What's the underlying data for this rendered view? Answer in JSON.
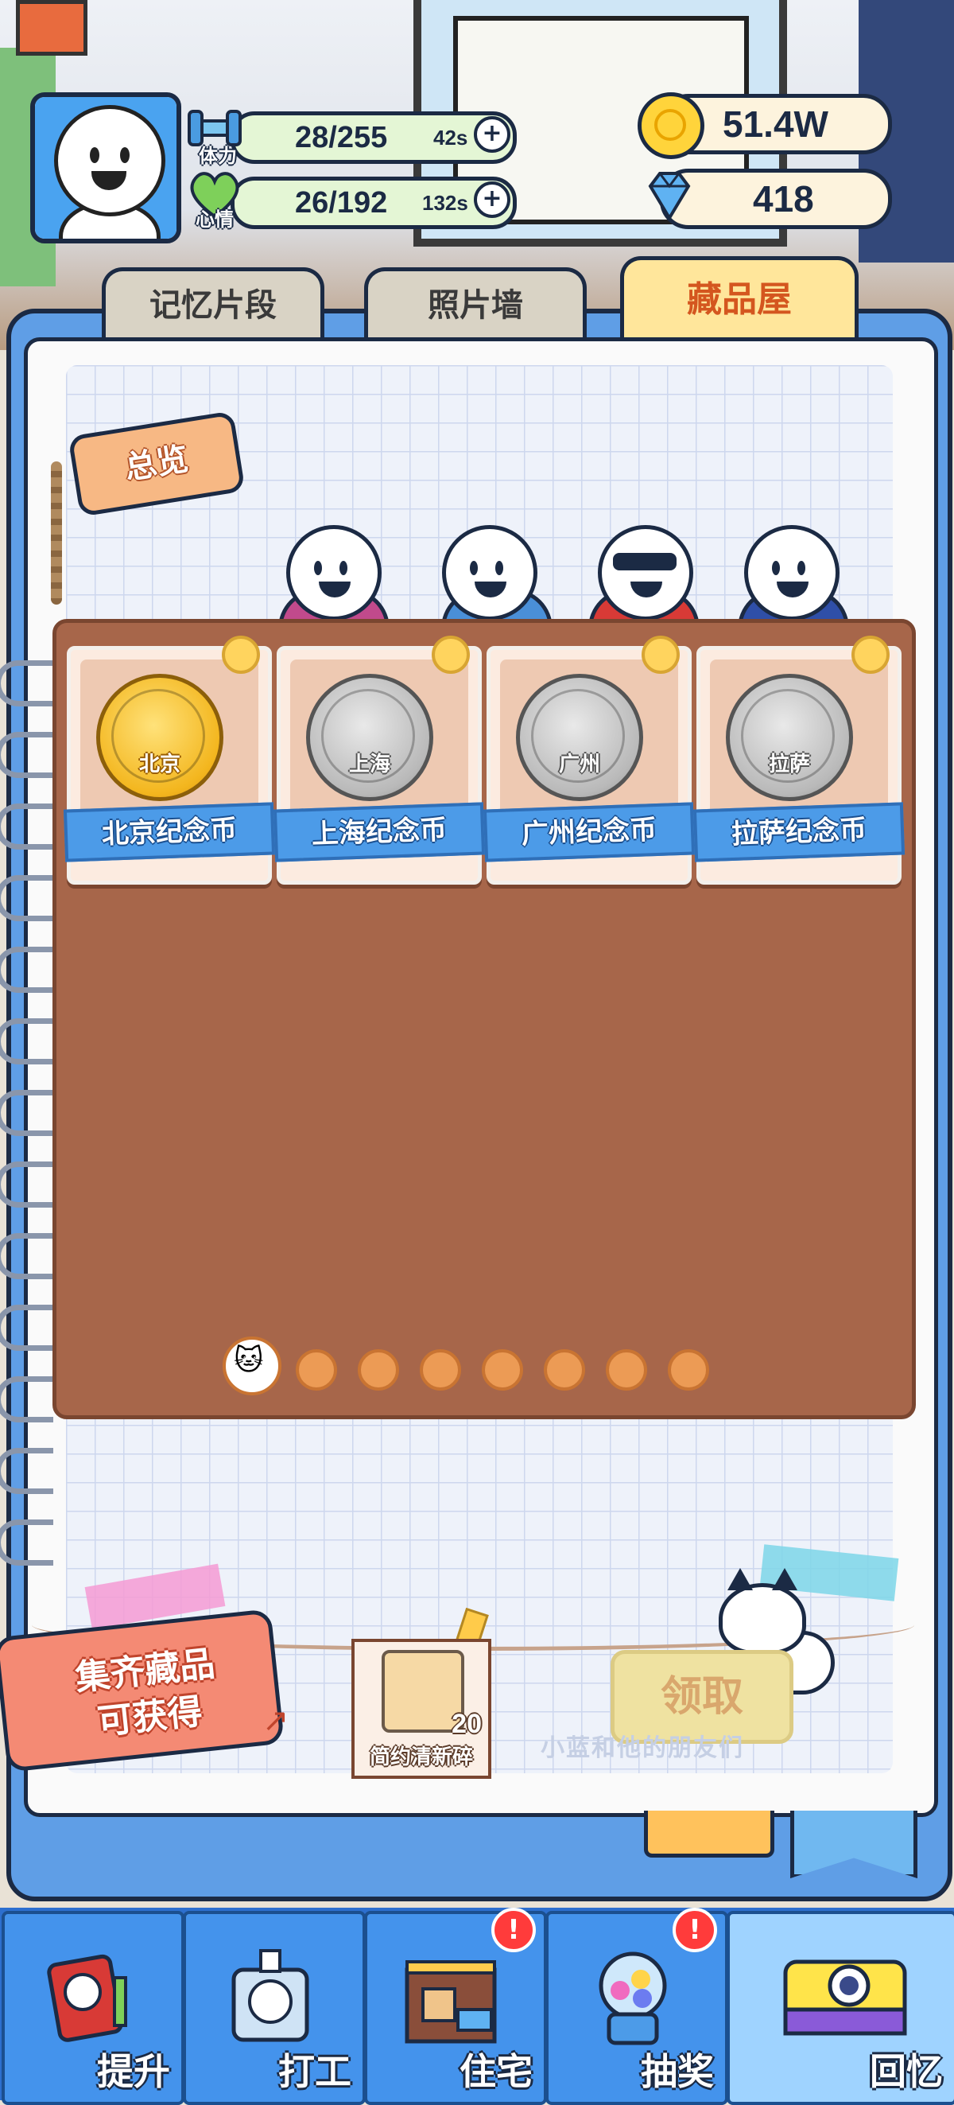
{
  "header": {
    "stamina": {
      "label": "体力",
      "value": "28/255",
      "timer": "42s"
    },
    "mood": {
      "label": "心情",
      "value": "26/192",
      "timer": "132s"
    },
    "coins": "51.4W",
    "gems": "418"
  },
  "tabs": [
    {
      "label": "记忆片段",
      "active": false
    },
    {
      "label": "照片墙",
      "active": false
    },
    {
      "label": "藏品屋",
      "active": true
    }
  ],
  "overview_tag": "总览",
  "collection": [
    {
      "name": "北京纪念币",
      "coin_text": "北京",
      "finish": "gold"
    },
    {
      "name": "上海纪念币",
      "coin_text": "上海",
      "finish": "silver"
    },
    {
      "name": "广州纪念币",
      "coin_text": "广州",
      "finish": "silver"
    },
    {
      "name": "拉萨纪念币",
      "coin_text": "拉萨",
      "finish": "silver"
    }
  ],
  "pager": {
    "pages": 8,
    "current": 1
  },
  "reward": {
    "line1": "集齐藏品",
    "line2": "可获得",
    "item_name": "简约清新碎",
    "item_count": "20",
    "claim_label": "领取",
    "watermark": "小蓝和他的朋友们"
  },
  "nav": [
    {
      "label": "提升",
      "icon": "book-icon",
      "badge": false
    },
    {
      "label": "打工",
      "icon": "worker-badge-icon",
      "badge": false
    },
    {
      "label": "住宅",
      "icon": "house-icon",
      "badge": true
    },
    {
      "label": "抽奖",
      "icon": "gacha-machine-icon",
      "badge": true
    },
    {
      "label": "回忆",
      "icon": "camera-icon",
      "badge": false
    }
  ],
  "badge_symbol": "!",
  "colors": {
    "accent": "#4493ec",
    "active_tab_text": "#d4561f",
    "panel": "#a7664a"
  }
}
